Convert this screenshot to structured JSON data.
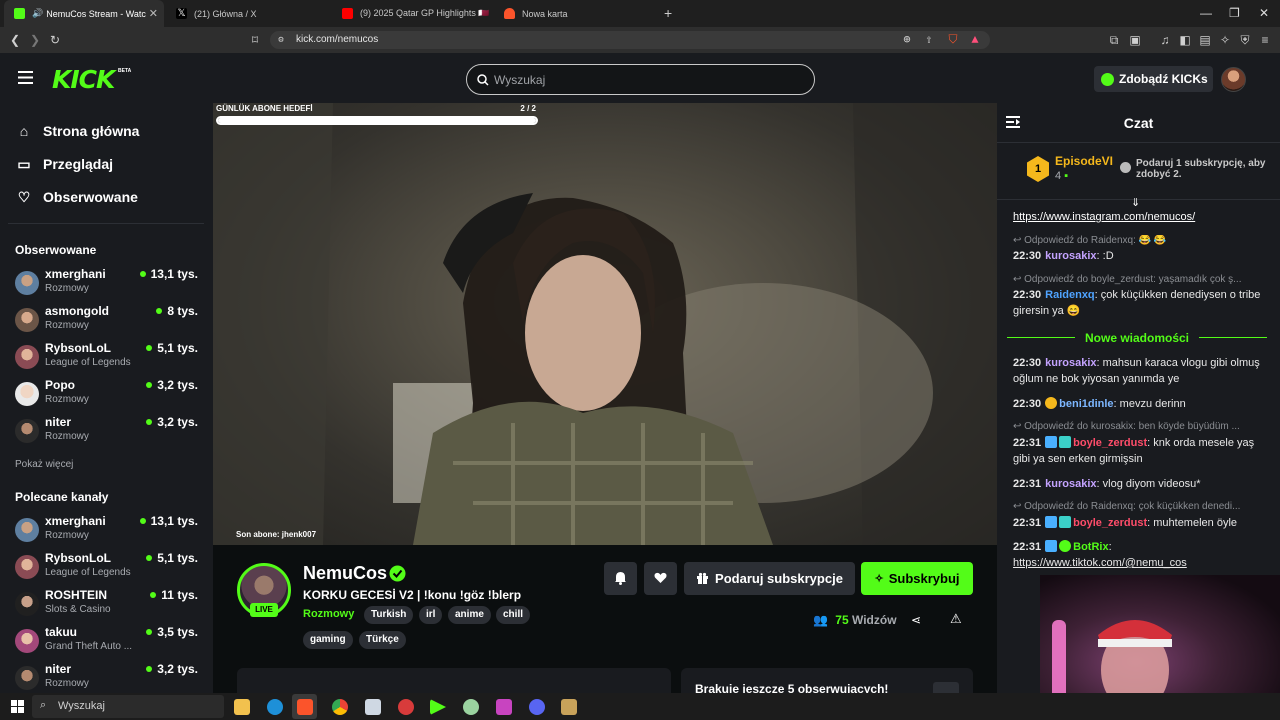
{
  "browser": {
    "tabs": [
      {
        "title": "NemuCos Stream - Watch Live",
        "active": true
      },
      {
        "title": "(21) Główna / X",
        "active": false
      },
      {
        "title": "(9) 2025 Qatar GP Highlights 🇶🇦 - Yo",
        "active": false
      },
      {
        "title": "Nowa karta",
        "active": false
      }
    ],
    "new_tab": "+",
    "url": "kick.com/nemucos"
  },
  "site": {
    "logo": "KICK",
    "beta": "BETA",
    "search_placeholder": "Wyszukaj",
    "get_kicks": "Zdobądź KICKs",
    "brand_color": "#53fc18"
  },
  "sidebar": {
    "nav": [
      {
        "label": "Strona główna",
        "icon": "home-icon"
      },
      {
        "label": "Przeglądaj",
        "icon": "browse-icon"
      },
      {
        "label": "Obserwowane",
        "icon": "heart-icon"
      }
    ],
    "followed_title": "Obserwowane",
    "followed": [
      {
        "name": "xmerghani",
        "category": "Rozmowy",
        "viewers": "13,1 tys."
      },
      {
        "name": "asmongold",
        "category": "Rozmowy",
        "viewers": "8 tys."
      },
      {
        "name": "RybsonLoL",
        "category": "League of Legends",
        "viewers": "5,1 tys."
      },
      {
        "name": "Popo",
        "category": "Rozmowy",
        "viewers": "3,2 tys."
      },
      {
        "name": "niter",
        "category": "Rozmowy",
        "viewers": "3,2 tys."
      }
    ],
    "show_more": "Pokaż więcej",
    "recommended_title": "Polecane kanały",
    "recommended": [
      {
        "name": "xmerghani",
        "category": "Rozmowy",
        "viewers": "13,1 tys."
      },
      {
        "name": "RybsonLoL",
        "category": "League of Legends",
        "viewers": "5,1 tys."
      },
      {
        "name": "ROSHTEIN",
        "category": "Slots & Casino",
        "viewers": "11 tys."
      },
      {
        "name": "takuu",
        "category": "Grand Theft Auto ...",
        "viewers": "3,5 tys."
      },
      {
        "name": "niter",
        "category": "Rozmowy",
        "viewers": "3,2 tys."
      }
    ]
  },
  "video": {
    "goal_label": "GÜNLÜK ABONE HEDEFİ",
    "goal_count": "2 / 2",
    "goal_progress": 1.0,
    "last_sub": "Son abone: jhenk007"
  },
  "stream": {
    "channel": "NemuCos",
    "live": "LIVE",
    "title": "KORKU GECESİ V2 | !konu !göz !blerp",
    "category": "Rozmowy",
    "tags": [
      "Turkish",
      "irl",
      "anime",
      "chill",
      "gaming",
      "Türkçe"
    ],
    "gift_label": "Podaruj subskrypcje",
    "subscribe_label": "Subskrybuj",
    "viewers_count": "75",
    "viewers_label": "Widzów",
    "panel_text": "Brakuje jeszcze 5 obserwujących!"
  },
  "chat": {
    "title": "Czat",
    "pinned": {
      "user": "EpisodeVI",
      "count": "4",
      "rank": "1",
      "gift_text": "Podaruj 1 subskrypcję, aby zdobyć 2."
    },
    "new_messages": "Nowe wiadomości",
    "messages": [
      {
        "kind": "text",
        "text": "https://www.instagram.com/nemucos/"
      },
      {
        "kind": "reply",
        "text": "↩ Odpowiedź do Raidenxq: 😂 😂"
      },
      {
        "kind": "msg",
        "time": "22:30",
        "user": "kurosakix",
        "color": "#c4a3ff",
        "text": ":D"
      },
      {
        "kind": "reply",
        "text": "↩ Odpowiedź do boyle_zerdust: yaşamadık çok ş..."
      },
      {
        "kind": "msg",
        "time": "22:30",
        "user": "Raidenxq",
        "color": "#4fa3ff",
        "text": "çok küçükken denediysen o tribe girersin ya 😄"
      },
      {
        "kind": "msg",
        "time": "22:30",
        "user": "kurosakix",
        "color": "#c4a3ff",
        "text": "mahsun karaca vlogu gibi olmuş oğlum ne bok yiyosan yanımda ye"
      },
      {
        "kind": "msg",
        "time": "22:30",
        "user": "beni1dinle",
        "color": "#7db7ff",
        "text": "mevzu derinn"
      },
      {
        "kind": "reply",
        "text": "↩ Odpowiedź do kurosakix: ben köyde büyüdüm ..."
      },
      {
        "kind": "msg",
        "time": "22:31",
        "user": "boyle_zerdust",
        "color": "#ff4d6a",
        "text": "knk orda mesele yaş gibi ya sen erken girmişsin"
      },
      {
        "kind": "msg",
        "time": "22:31",
        "user": "kurosakix",
        "color": "#c4a3ff",
        "text": "vlog diyom videosu*"
      },
      {
        "kind": "reply",
        "text": "↩ Odpowiedź do Raidenxq: çok küçükken denedi..."
      },
      {
        "kind": "msg",
        "time": "22:31",
        "user": "boyle_zerdust",
        "color": "#ff4d6a",
        "text": "muhtemelen öyle"
      },
      {
        "kind": "msg",
        "time": "22:31",
        "user": "BotRix",
        "color": "#53fc18",
        "text": ""
      },
      {
        "kind": "text",
        "text": "https://www.tiktok.com/@nemu_cos"
      }
    ]
  },
  "taskbar": {
    "search": "Wyszukaj"
  }
}
